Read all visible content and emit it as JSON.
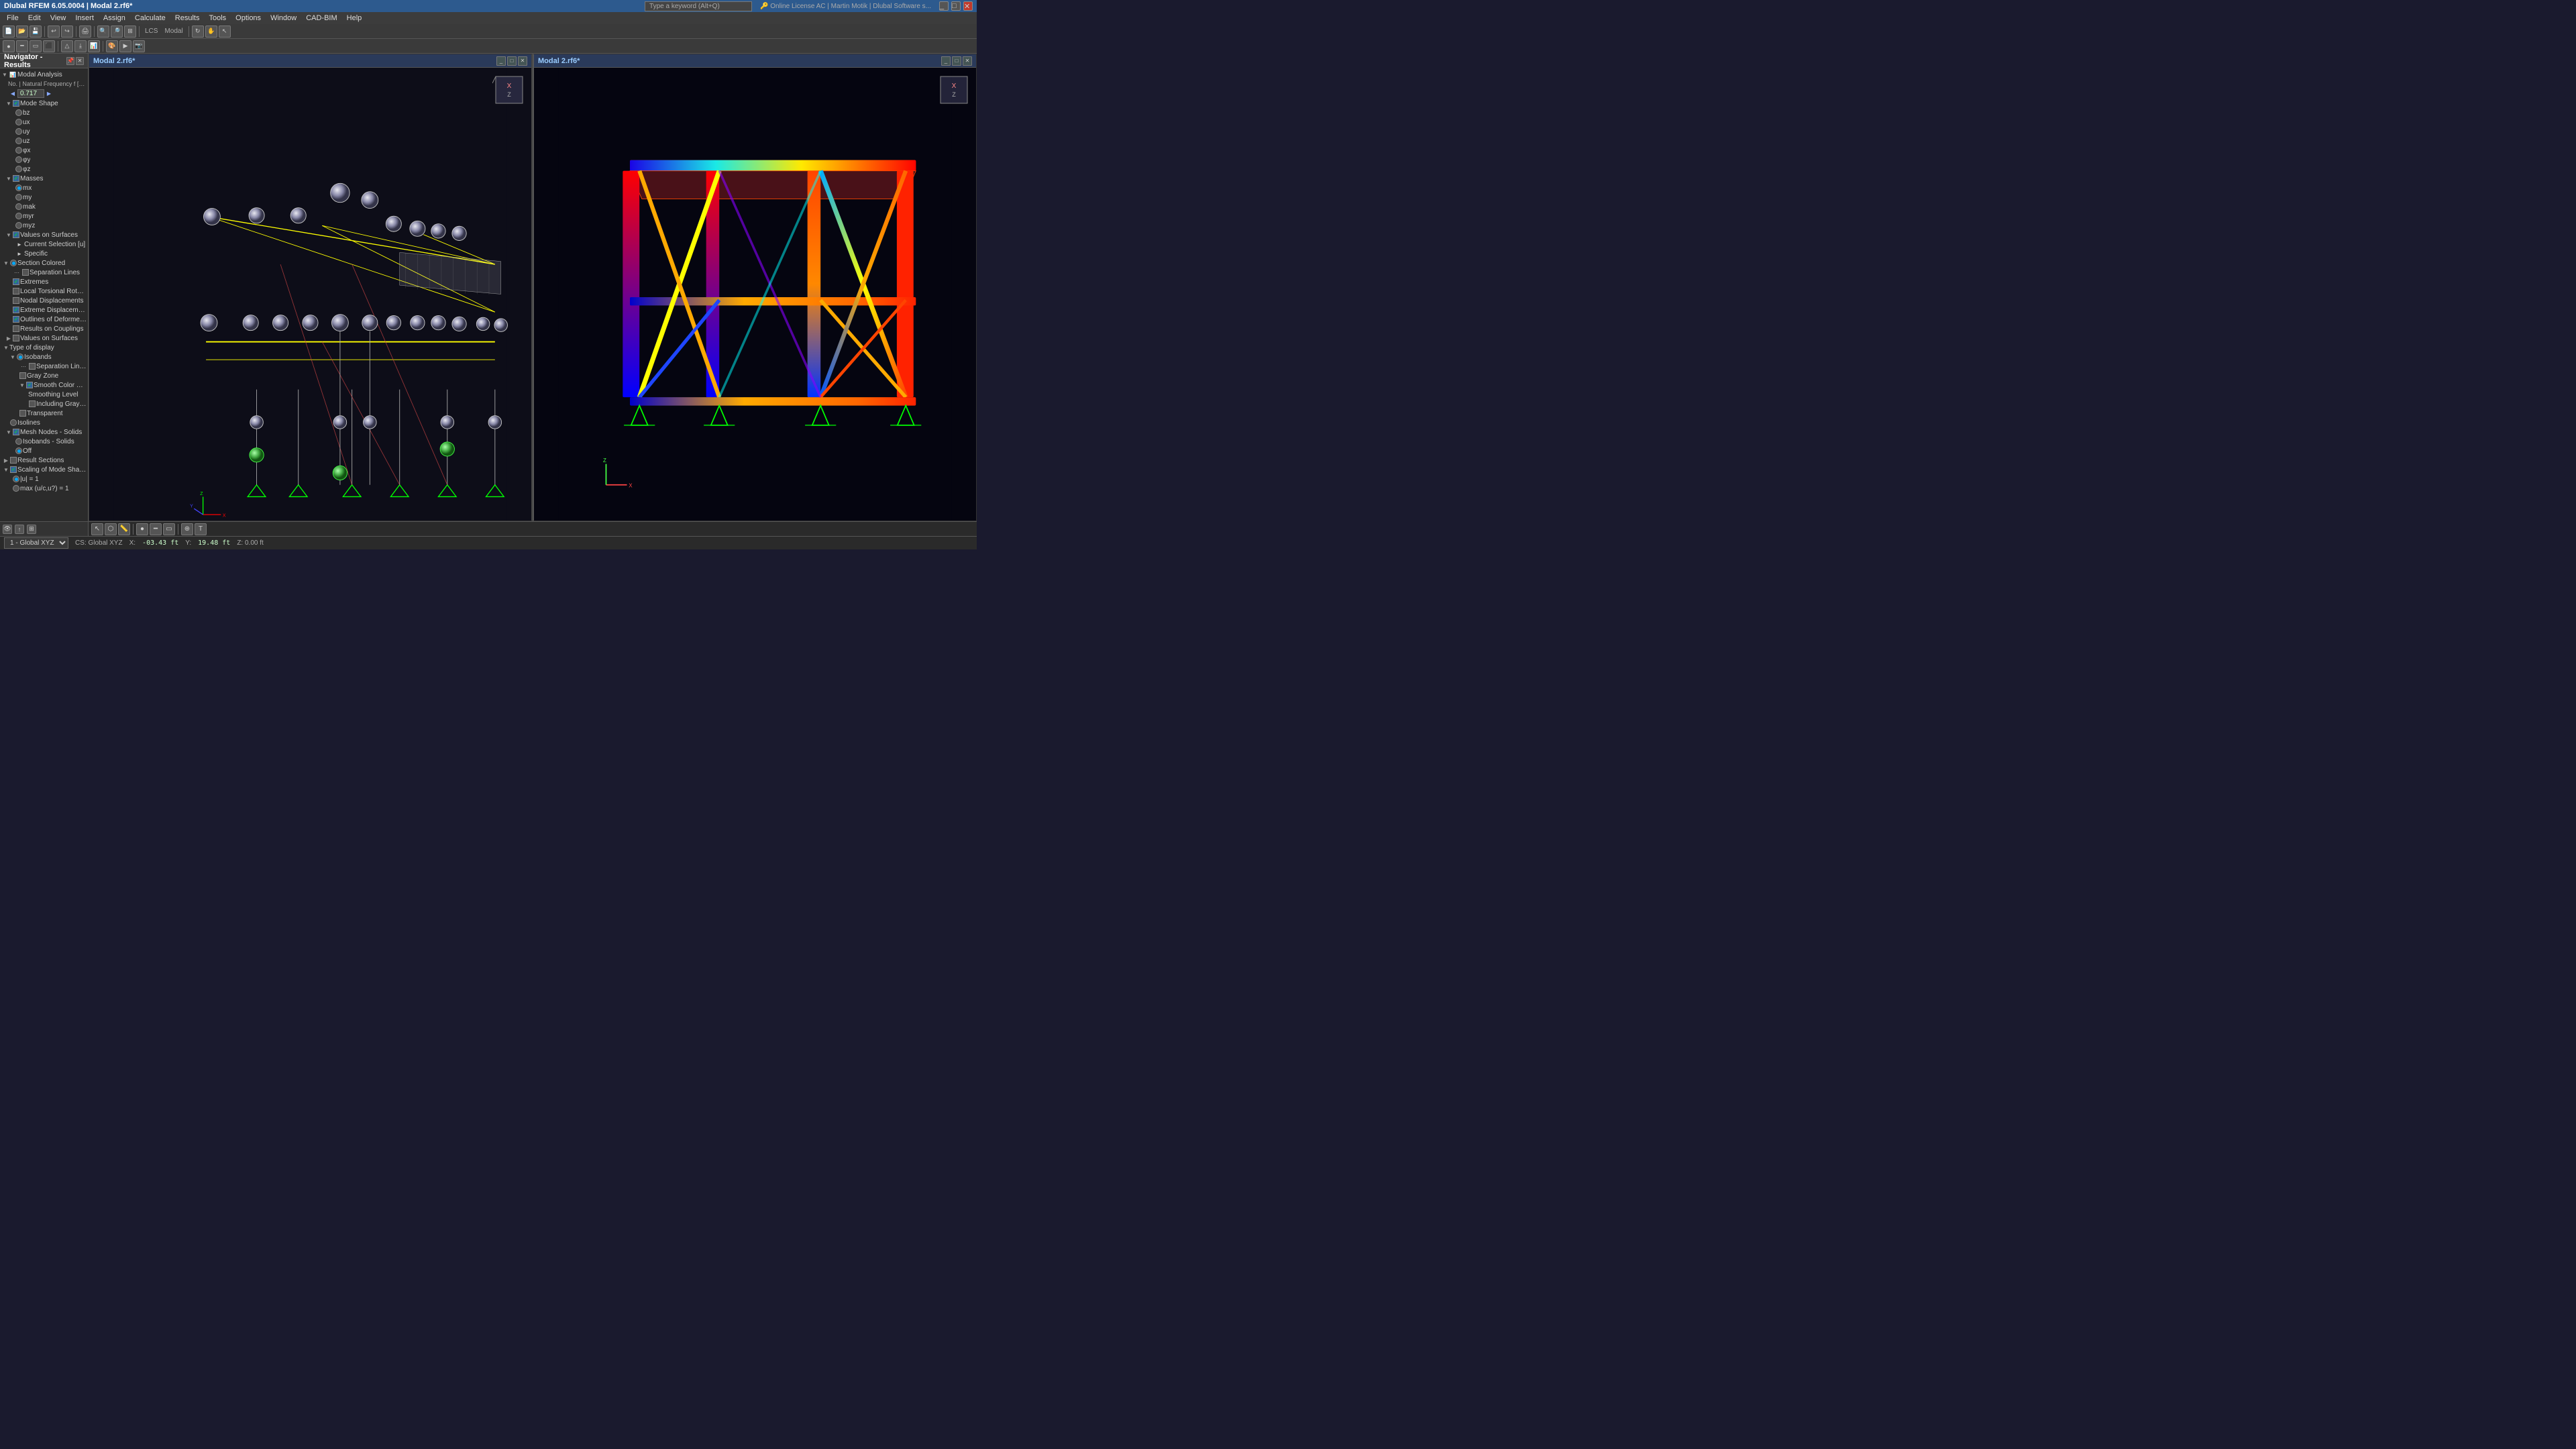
{
  "app": {
    "title": "Dlubal RFEM 6.05.0004 | Modal 2.rf6*",
    "lcs_label": "LCS",
    "modal_label": "Modal"
  },
  "titlebar": {
    "minimize": "_",
    "maximize": "□",
    "close": "✕"
  },
  "menubar": {
    "items": [
      "File",
      "Edit",
      "View",
      "Insert",
      "Assign",
      "Calculate",
      "Results",
      "Tools",
      "Options",
      "Window",
      "CAD-BIM",
      "Help"
    ]
  },
  "navigator": {
    "title": "Navigator - Results",
    "sections": [
      {
        "label": "Modal Analysis",
        "expanded": true,
        "children": [
          {
            "label": "No. | Natural Frequency f [Hz]",
            "value": "0.717",
            "type": "dropdown"
          },
          {
            "label": "Mode Shape",
            "type": "group",
            "expanded": true,
            "children": [
              {
                "label": "bz",
                "type": "radio",
                "checked": false
              },
              {
                "label": "ux",
                "type": "radio",
                "checked": false
              },
              {
                "label": "uy",
                "type": "radio",
                "checked": false
              },
              {
                "label": "uz",
                "type": "radio",
                "checked": false
              },
              {
                "label": "φx",
                "type": "radio",
                "checked": false
              },
              {
                "label": "φy",
                "type": "radio",
                "checked": false
              },
              {
                "label": "φz",
                "type": "radio",
                "checked": false
              }
            ]
          },
          {
            "label": "Masses",
            "type": "group",
            "expanded": true,
            "children": [
              {
                "label": "mx",
                "type": "radio",
                "checked": true
              },
              {
                "label": "my",
                "type": "radio",
                "checked": false
              },
              {
                "label": "mak",
                "type": "radio",
                "checked": false
              },
              {
                "label": "myr",
                "type": "radio",
                "checked": false
              },
              {
                "label": "myz",
                "type": "radio",
                "checked": false
              }
            ]
          },
          {
            "label": "Values on Surfaces",
            "type": "group",
            "expanded": true,
            "children": [
              {
                "label": "Current Selection [u]",
                "type": "item"
              },
              {
                "label": "Specific",
                "type": "item"
              }
            ]
          }
        ]
      },
      {
        "label": "Section Colored",
        "type": "group",
        "expanded": true,
        "checkbox": true,
        "checked": true,
        "children": [
          {
            "label": "Separation Lines",
            "type": "checkbox",
            "checked": false
          },
          {
            "label": "Extremes",
            "type": "checkbox",
            "checked": true
          },
          {
            "label": "Local Torsional Rotatio...",
            "type": "checkbox",
            "checked": false
          },
          {
            "label": "Nodal Displacements",
            "type": "checkbox",
            "checked": false
          },
          {
            "label": "Extreme Displacement",
            "type": "checkbox",
            "checked": true
          },
          {
            "label": "Outlines of Deformed Surf...",
            "type": "checkbox",
            "checked": true
          },
          {
            "label": "Values on Surfaces",
            "type": "group"
          },
          {
            "label": "Results on Couplings",
            "type": "checkbox",
            "checked": false
          }
        ]
      },
      {
        "label": "Values on Surfaces",
        "type": "checkbox",
        "checked": false
      },
      {
        "label": "Type of display",
        "type": "group",
        "expanded": true,
        "children": [
          {
            "label": "Isobands",
            "type": "radio",
            "checked": true,
            "children": [
              {
                "label": "Separation Lines",
                "type": "checkbox",
                "checked": false
              },
              {
                "label": "Gray Zone",
                "type": "checkbox",
                "checked": false
              },
              {
                "label": "Smooth Color Transi...",
                "type": "checkbox",
                "checked": true,
                "children": [
                  {
                    "label": "Smoothing Level",
                    "type": "item"
                  },
                  {
                    "label": "Including Gray Zo...",
                    "type": "checkbox",
                    "checked": false
                  }
                ]
              },
              {
                "label": "Transparent",
                "type": "checkbox",
                "checked": false
              }
            ]
          },
          {
            "label": "Isolines",
            "type": "radio",
            "checked": false
          },
          {
            "label": "Mesh Nodes - Solids",
            "type": "checkbox",
            "checked": true,
            "children": [
              {
                "label": "Isobands - Solids",
                "type": "radio",
                "checked": false
              },
              {
                "label": "Off",
                "type": "radio",
                "checked": true
              }
            ]
          }
        ]
      },
      {
        "label": "Result Sections",
        "type": "checkbox",
        "checked": false
      },
      {
        "label": "Scaling of Mode Shapes",
        "type": "group",
        "expanded": true,
        "children": [
          {
            "label": "|u| = 1",
            "type": "radio",
            "checked": true
          },
          {
            "label": "max (u/c,u?) = 1",
            "type": "radio",
            "checked": false
          }
        ]
      }
    ]
  },
  "views": [
    {
      "id": "left",
      "title": "Modal 2.rf6*",
      "type": "wireframe_modal"
    },
    {
      "id": "right",
      "title": "Modal 2.rf6*",
      "type": "colored_modal"
    }
  ],
  "statusbar": {
    "cs_label": "CS: Global XYZ",
    "x_label": "X:",
    "x_value": "-03.43 ft",
    "y_label": "Y:",
    "y_value": "19.48 ft",
    "z_label": "Z: 0.00 ft"
  },
  "nav_cube": {
    "face": "X",
    "secondary": "Z"
  },
  "bottom_toolbar_items": [
    "pointer",
    "snap",
    "measure",
    "section",
    "annotation"
  ]
}
